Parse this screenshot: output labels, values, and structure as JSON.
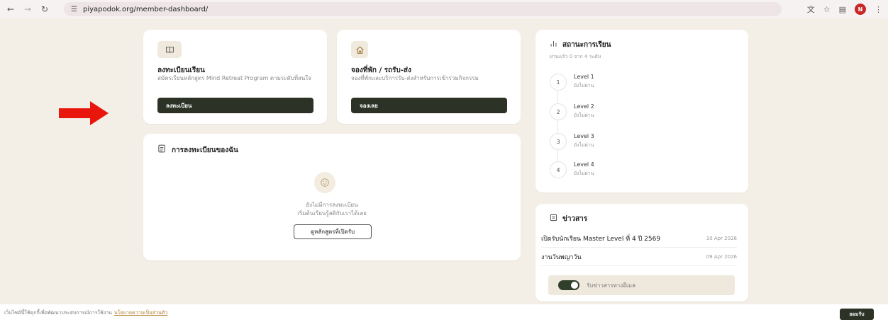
{
  "browser": {
    "url": "piyapodok.org/member-dashboard/",
    "profile_initial": "N"
  },
  "register_card": {
    "title": "ลงทะเบียนเรียน",
    "description": "สมัครเรียนหลักสูตร Mind Retreat Program ตามระดับที่สนใจ",
    "button": "ลงทะเบียน"
  },
  "booking_card": {
    "title": "จองที่พัก / รถรับ-ส่ง",
    "description": "จองที่พักและบริการรับ-ส่งสำหรับการเข้าร่วมกิจกรรม",
    "button": "จองเลย"
  },
  "my_registrations": {
    "title": "การลงทะเบียนของฉัน",
    "empty_line1": "ยังไม่มีการลงทะเบียน",
    "empty_line2": "เริ่มต้นเรียนรู้สติกับเราได้เลย",
    "button": "ดูหลักสูตรที่เปิดรับ"
  },
  "study_status": {
    "title": "สถานะการเรียน",
    "subtitle": "ผ่านแล้ว 0 จาก 4 ระดับ",
    "steps": [
      {
        "number": "1",
        "level": "Level 1",
        "status": "ยังไม่ผ่าน"
      },
      {
        "number": "2",
        "level": "Level 2",
        "status": "ยังไม่ผ่าน"
      },
      {
        "number": "3",
        "level": "Level 3",
        "status": "ยังไม่ผ่าน"
      },
      {
        "number": "4",
        "level": "Level 4",
        "status": "ยังไม่ผ่าน"
      }
    ]
  },
  "news": {
    "title": "ข่าวสาร",
    "items": [
      {
        "title": "เปิดรับนักเรียน Master Level ที่ 4 ปี 2569",
        "date": "10 Apr 2026"
      },
      {
        "title": "งานวันพญาวัน",
        "date": "09 Apr 2026"
      }
    ],
    "toggle_label": "รับข่าวสารทางอีเมล",
    "toggle_on": true
  },
  "cookie_bar": {
    "text": "เว็บไซต์นี้ใช้คุกกี้เพื่อพัฒนาประสบการณ์การใช้งาน",
    "link": "นโยบายความเป็นส่วนตัว",
    "button": "ยอมรับ"
  },
  "colors": {
    "page_bg": "#f4efe6",
    "dark_green": "#2c3326",
    "arrow_red": "#e8160c",
    "icon_bg": "#efeadd"
  }
}
